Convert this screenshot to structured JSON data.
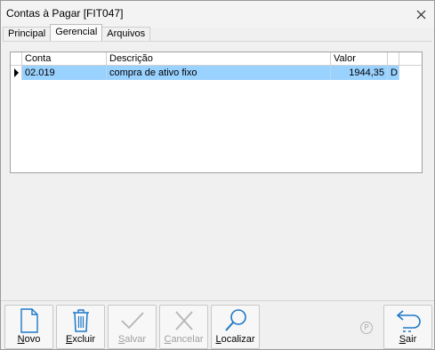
{
  "window": {
    "title": "Contas à Pagar [FIT047]"
  },
  "tabs": [
    {
      "label": "Principal",
      "active": false
    },
    {
      "label": "Gerencial",
      "active": true
    },
    {
      "label": "Arquivos",
      "active": false
    }
  ],
  "grid": {
    "columns": [
      "Conta",
      "Descrição",
      "Valor",
      ""
    ],
    "rows": [
      {
        "conta": "02.019",
        "descricao": "compra de ativo fixo",
        "valor": "1944,35",
        "flag": "D",
        "selected": true
      }
    ]
  },
  "toolbar": {
    "buttons": [
      {
        "label": "Novo",
        "accel": "N",
        "enabled": true,
        "icon": "document-icon"
      },
      {
        "label": "Excluir",
        "accel": "E",
        "enabled": true,
        "icon": "trash-icon"
      },
      {
        "label": "Salvar",
        "accel": "S",
        "enabled": false,
        "icon": "checkmark-icon"
      },
      {
        "label": "Cancelar",
        "accel": "C",
        "enabled": false,
        "icon": "x-icon"
      },
      {
        "label": "Localizar",
        "accel": "L",
        "enabled": true,
        "icon": "magnifier-icon"
      },
      {
        "label": "Sair",
        "accel": "S",
        "enabled": true,
        "icon": "return-arrow-icon"
      }
    ],
    "badge": "P"
  },
  "colors": {
    "accent": "#1e78c8",
    "selection": "#99d1ff",
    "disabled": "#a0a0a0"
  }
}
